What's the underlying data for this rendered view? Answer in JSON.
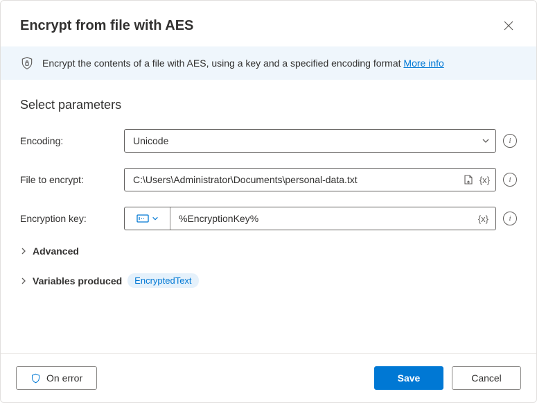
{
  "header": {
    "title": "Encrypt from file with AES"
  },
  "banner": {
    "text": "Encrypt the contents of a file with AES, using a key and a specified encoding format ",
    "link": "More info"
  },
  "section": {
    "title": "Select parameters"
  },
  "fields": {
    "encoding": {
      "label": "Encoding:",
      "value": "Unicode"
    },
    "file": {
      "label": "File to encrypt:",
      "value": "C:\\Users\\Administrator\\Documents\\personal-data.txt"
    },
    "key": {
      "label": "Encryption key:",
      "value": "%EncryptionKey%"
    }
  },
  "expanders": {
    "advanced": "Advanced",
    "variables": "Variables produced",
    "variableName": "EncryptedText"
  },
  "footer": {
    "onError": "On error",
    "save": "Save",
    "cancel": "Cancel"
  },
  "tokens": {
    "var": "{x}"
  }
}
